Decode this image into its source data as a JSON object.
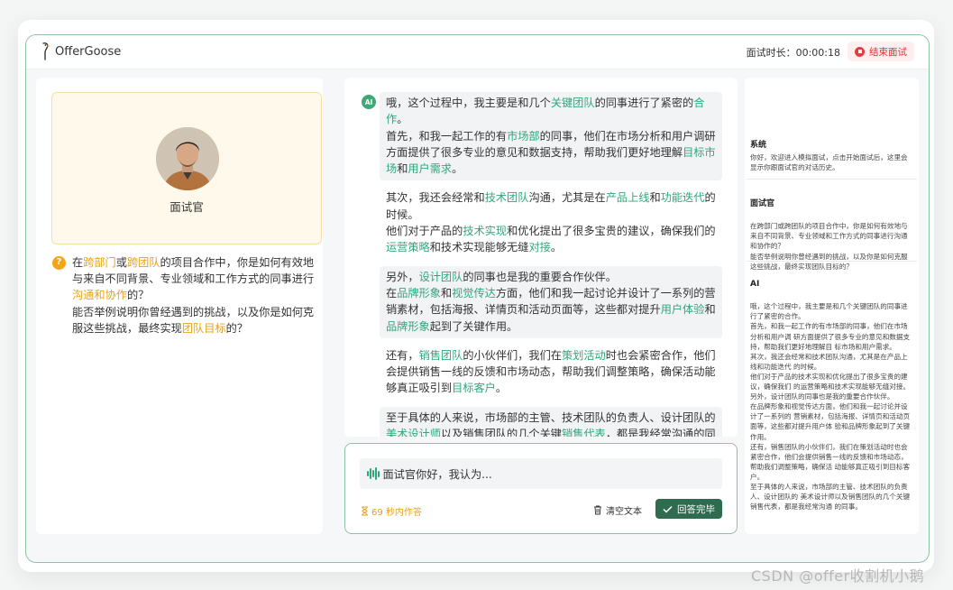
{
  "app": {
    "name": "OfferGoose"
  },
  "header": {
    "timer_label": "面试时长：00:00:18",
    "end_label": "结束面试"
  },
  "interviewer": {
    "name": "面试官"
  },
  "question": {
    "segments": [
      {
        "t": "在",
        "c": ""
      },
      {
        "t": "跨部门",
        "c": "hl"
      },
      {
        "t": "或",
        "c": ""
      },
      {
        "t": "跨团队",
        "c": "hl"
      },
      {
        "t": "的项目合作中，你是如何有效地与来自不同背景、专业领域和工作方式的同事进行",
        "c": ""
      },
      {
        "t": "沟通和协作",
        "c": "hl"
      },
      {
        "t": "的？",
        "c": ""
      }
    ],
    "segments2": [
      {
        "t": "能否举例说明你曾经遇到的挑战，以及你是如何克服这些挑战，最终实现",
        "c": ""
      },
      {
        "t": "团队目标",
        "c": "hl"
      },
      {
        "t": "的？",
        "c": ""
      }
    ]
  },
  "chat": {
    "ai_badge": "AI",
    "messages": [
      {
        "shaded": true,
        "segments": [
          {
            "t": "哦，这个过程中，我主要是和几个",
            "c": ""
          },
          {
            "t": "关键团队",
            "c": "g"
          },
          {
            "t": "的同事进行了紧密的",
            "c": ""
          },
          {
            "t": "合作",
            "c": "g"
          },
          {
            "t": "。",
            "c": ""
          },
          {
            "br": true
          },
          {
            "t": "首先，和我一起工作的有",
            "c": ""
          },
          {
            "t": "市场部",
            "c": "g"
          },
          {
            "t": "的同事，他们在市场分析和用户调研方面提供了很多专业的意见和数据支持，帮助我们更好地理解",
            "c": ""
          },
          {
            "t": "目标市场",
            "c": "g"
          },
          {
            "t": "和",
            "c": ""
          },
          {
            "t": "用户需求",
            "c": "g"
          },
          {
            "t": "。",
            "c": ""
          }
        ]
      },
      {
        "shaded": false,
        "segments": [
          {
            "t": "其次，我还会经常和",
            "c": ""
          },
          {
            "t": "技术团队",
            "c": "g"
          },
          {
            "t": "沟通，尤其是在",
            "c": ""
          },
          {
            "t": "产品上线",
            "c": "g"
          },
          {
            "t": "和",
            "c": ""
          },
          {
            "t": "功能迭代",
            "c": "g"
          },
          {
            "t": "的时候。",
            "c": ""
          },
          {
            "br": true
          },
          {
            "t": "他们对于产品的",
            "c": ""
          },
          {
            "t": "技术实现",
            "c": "g"
          },
          {
            "t": "和优化提出了很多宝贵的建议，确保我们的",
            "c": ""
          },
          {
            "t": "运营策略",
            "c": "g"
          },
          {
            "t": "和技术实现能够无缝",
            "c": ""
          },
          {
            "t": "对接",
            "c": "g"
          },
          {
            "t": "。",
            "c": ""
          }
        ]
      },
      {
        "shaded": true,
        "segments": [
          {
            "t": "另外，",
            "c": ""
          },
          {
            "t": "设计团队",
            "c": "g"
          },
          {
            "t": "的同事也是我的重要合作伙伴。",
            "c": ""
          },
          {
            "br": true
          },
          {
            "t": "在",
            "c": ""
          },
          {
            "t": "品牌形象",
            "c": "g"
          },
          {
            "t": "和",
            "c": ""
          },
          {
            "t": "视觉传达",
            "c": "g"
          },
          {
            "t": "方面，他们和我一起讨论并设计了一系列的营销素材，包括海报、详情页和活动页面等，这些都对提升",
            "c": ""
          },
          {
            "t": "用户体验",
            "c": "g"
          },
          {
            "t": "和",
            "c": ""
          },
          {
            "t": "品牌形象",
            "c": "g"
          },
          {
            "t": "起到了关键作用。",
            "c": ""
          }
        ]
      },
      {
        "shaded": false,
        "segments": [
          {
            "t": "还有，",
            "c": ""
          },
          {
            "t": "销售团队",
            "c": "g"
          },
          {
            "t": "的小伙伴们，我们在",
            "c": ""
          },
          {
            "t": "策划活动",
            "c": "g"
          },
          {
            "t": "时也会紧密合作，他们会提供销售一线的反馈和市场动态，帮助我们调整策略，确保活动能够真正吸引到",
            "c": ""
          },
          {
            "t": "目标客户",
            "c": "g"
          },
          {
            "t": "。",
            "c": ""
          }
        ]
      },
      {
        "shaded": true,
        "segments": [
          {
            "t": "至于具体的人来说，市场部的主管、技术团队的负责人、设计团队的",
            "c": ""
          },
          {
            "t": "美术设计师",
            "c": "g"
          },
          {
            "t": "以及销售团队的几个关键",
            "c": ""
          },
          {
            "t": "销售代表",
            "c": "g"
          },
          {
            "t": "，都是我经常沟通的同事。",
            "c": ""
          }
        ]
      }
    ]
  },
  "input": {
    "value": "面试官你好，我认为...",
    "time_limit": "69 秒内作答",
    "clear_label": "清空文本",
    "done_label": "回答完毕"
  },
  "history": [
    {
      "role": "系统",
      "text": "你好，欢迎进入模拟面试，点击开始面试后，这里会显示你跟面试官的对话历史。"
    },
    {
      "role": "面试官",
      "text": "在跨部门或跨团队的项目合作中，你是如何有效地与来自不同背景、专业领域和工作方式的同事进行沟通和协作的？\n能否举例说明你曾经遇到的挑战，以及你是如何克服这些挑战，最终实现团队目标的？"
    },
    {
      "role": "AI",
      "text": "哦，这个过程中，我主要是和几个关键团队的同事进行了紧密的合作。\n首先，和我一起工作的有市场部的同事，他们在市场分析和用户调 研方面提供了很多专业的意见和数据支持，帮助我们更好地理解目 标市场和用户需求。\n其次，我还会经常和技术团队沟通，尤其是在产品上线和功能迭代 的时候。\n他们对于产品的技术实现和优化提出了很多宝贵的建议，确保我们 的运营策略和技术实现能够无缝对接。\n另外，设计团队的同事也是我的重要合作伙伴。\n在品牌形象和视觉传达方面，他们和我一起讨论并设计了一系列的 营销素材，包括海报、详情页和活动页面等，这些都对提升用户体 验和品牌形象起到了关键作用。\n还有，销售团队的小伙伴们，我们在策划活动时也会紧密合作，他们会提供销售一线的反馈和市场动态，帮助我们调整策略，确保活 动能够真正吸引到目标客户。\n至于具体的人来说，市场部的主管、技术团队的负责人、设计团队的 美术设计师以及销售团队的几个关键销售代表，都是我经常沟通 的同事。"
    }
  ],
  "watermark": "CSDN @offer收割机小鹅",
  "colors": {
    "accent": "#2fa77b",
    "highlight": "#e7a317",
    "danger": "#e43c3c",
    "primary_button": "#2e6b4f"
  }
}
